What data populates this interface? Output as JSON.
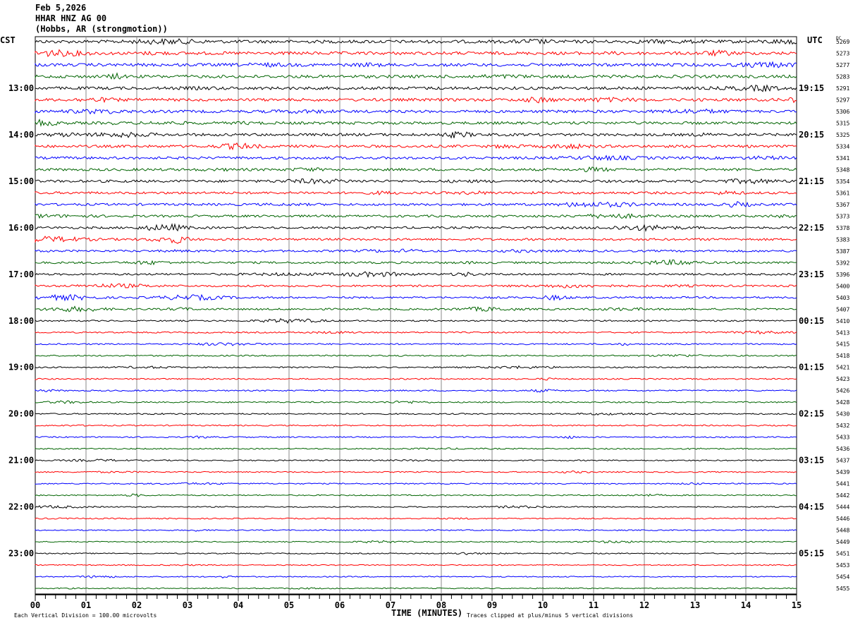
{
  "header": {
    "date": "Feb 5,2026",
    "station": "HHAR HNZ AG 00",
    "location": "(Hobbs, AR (strongmotion))"
  },
  "chart_data": {
    "type": "line",
    "subtype": "helicorder",
    "left_axis_label": "CST",
    "right_axis_label": "UTC",
    "dc_label": "DC",
    "xlabel": "TIME (MINUTES)",
    "xlim": [
      0,
      15
    ],
    "x_ticks": [
      "00",
      "01",
      "02",
      "03",
      "04",
      "05",
      "06",
      "07",
      "08",
      "09",
      "10",
      "11",
      "12",
      "13",
      "14",
      "15"
    ],
    "left_hour_labels": [
      "13:00",
      "14:00",
      "15:00",
      "16:00",
      "17:00",
      "18:00",
      "19:00",
      "20:00",
      "21:00",
      "22:00",
      "23:00"
    ],
    "right_hour_labels": [
      "19:15",
      "20:15",
      "21:15",
      "22:15",
      "23:15",
      "00:15",
      "01:15",
      "02:15",
      "03:15",
      "04:15",
      "05:15"
    ],
    "dc_offsets": [
      "5269",
      "5273",
      "5277",
      "5283",
      "5291",
      "5297",
      "5306",
      "5315",
      "5325",
      "5334",
      "5341",
      "5348",
      "5354",
      "5361",
      "5367",
      "5373",
      "5378",
      "5383",
      "5387",
      "5392",
      "5396",
      "5400",
      "5403",
      "5407",
      "5410",
      "5413",
      "5415",
      "5418",
      "5421",
      "5423",
      "5426",
      "5428",
      "5430",
      "5432",
      "5433",
      "5436",
      "5437",
      "5439",
      "5441",
      "5442",
      "5444",
      "5446",
      "5448",
      "5449",
      "5451",
      "5453",
      "5454",
      "5455"
    ],
    "trace_colors": [
      "#000000",
      "#ff0000",
      "#0000ff",
      "#006400"
    ],
    "grid": true,
    "scale_note": "Each Vertical Division =  100.00 microvolts",
    "clip_note": "Traces clipped at plus/minus 5 vertical divisions"
  }
}
